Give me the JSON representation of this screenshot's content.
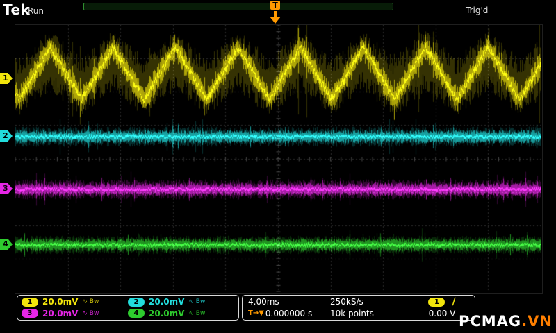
{
  "header": {
    "logo": "Tek",
    "acq_status": "Run",
    "trig_status": "Trig'd",
    "trigger_flag": "T"
  },
  "channels": [
    {
      "id": "1",
      "color": "#f2e50c",
      "scale": "20.0mV",
      "icons": "∿ Bᴡ"
    },
    {
      "id": "2",
      "color": "#22dddd",
      "scale": "20.0mV",
      "icons": "∿ Bᴡ"
    },
    {
      "id": "3",
      "color": "#e626e6",
      "scale": "20.0mV",
      "icons": "∿ Bᴡ"
    },
    {
      "id": "4",
      "color": "#2ecc2e",
      "scale": "20.0mV",
      "icons": "∿ Bᴡ"
    }
  ],
  "timebase": {
    "scale": "4.00ms",
    "sample_rate": "250kS/s",
    "trigger_position_icon": "T→▼",
    "trigger_time": "0.000000 s",
    "record_length": "10k points"
  },
  "trigger": {
    "source": "1",
    "slope_glyph": "∕",
    "level": "0.00 V"
  },
  "watermark": {
    "main": "PCMAG",
    "suffix": ".VN"
  },
  "waveforms": [
    {
      "name": "channel-1",
      "seed": 101,
      "color": "#f2e50c",
      "type": "triangle",
      "baseline": 70,
      "amplitude": 38,
      "period": 90,
      "phase": -0.056,
      "noise_outer": 36,
      "noise_inner": 8,
      "marker": 78
    },
    {
      "name": "channel-2",
      "seed": 202,
      "color": "#22dddd",
      "type": "flat",
      "baseline": 161,
      "amplitude": 0,
      "period": 0,
      "phase": 0,
      "noise_outer": 12,
      "noise_inner": 4,
      "marker": 161
    },
    {
      "name": "channel-3",
      "seed": 303,
      "color": "#e626e6",
      "type": "flat",
      "baseline": 237,
      "amplitude": 0,
      "period": 0,
      "phase": 0,
      "noise_outer": 12,
      "noise_inner": 4,
      "marker": 237
    },
    {
      "name": "channel-4",
      "seed": 404,
      "color": "#2ecc2e",
      "type": "flat",
      "baseline": 317,
      "amplitude": 0,
      "period": 0,
      "phase": 0,
      "noise_outer": 11,
      "noise_inner": 4,
      "marker": 317
    }
  ]
}
